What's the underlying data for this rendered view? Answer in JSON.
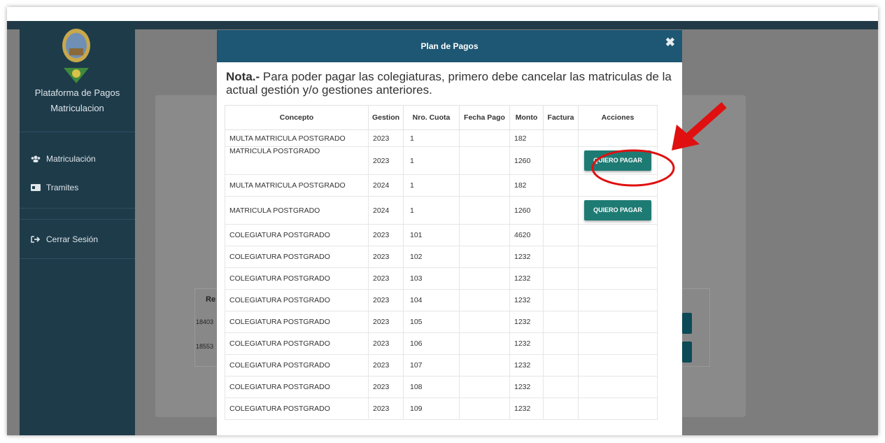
{
  "sidebar": {
    "brand_line1": "Plataforma de Pagos",
    "brand_line2": "Matriculacion",
    "items": [
      {
        "label": "Matriculación",
        "icon": "users-icon"
      },
      {
        "label": "Tramites",
        "icon": "id-card-icon"
      },
      {
        "label": "Cerrar Sesión",
        "icon": "sign-out-icon"
      }
    ]
  },
  "background": {
    "header_fragment": "Re",
    "row1_fragment": "18403",
    "row2_fragment": "18553"
  },
  "modal": {
    "title": "Plan de Pagos",
    "close_symbol": "✖",
    "note_bold": "Nota.-",
    "note_text": " Para poder pagar las colegiaturas, primero debe cancelar las matriculas de la actual gestión y/o gestiones anteriores."
  },
  "table": {
    "headers": [
      "Concepto",
      "Gestion",
      "Nro. Cuota",
      "Fecha Pago",
      "Monto",
      "Factura",
      "Acciones"
    ],
    "pay_label": "QUIERO PAGAR",
    "rows": [
      {
        "concepto": "MULTA MATRICULA POSTGRADO",
        "gestion": "2023",
        "cuota": "1",
        "fecha": "",
        "monto": "182",
        "factura": "",
        "accion": false
      },
      {
        "concepto": "MATRICULA POSTGRADO",
        "gestion": "2023",
        "cuota": "1",
        "fecha": "",
        "monto": "1260",
        "factura": "",
        "accion": true
      },
      {
        "concepto": "MULTA MATRICULA POSTGRADO",
        "gestion": "2024",
        "cuota": "1",
        "fecha": "",
        "monto": "182",
        "factura": "",
        "accion": false
      },
      {
        "concepto": "MATRICULA POSTGRADO",
        "gestion": "2024",
        "cuota": "1",
        "fecha": "",
        "monto": "1260",
        "factura": "",
        "accion": true
      },
      {
        "concepto": "COLEGIATURA POSTGRADO",
        "gestion": "2023",
        "cuota": "101",
        "fecha": "",
        "monto": "4620",
        "factura": "",
        "accion": false
      },
      {
        "concepto": "COLEGIATURA POSTGRADO",
        "gestion": "2023",
        "cuota": "102",
        "fecha": "",
        "monto": "1232",
        "factura": "",
        "accion": false
      },
      {
        "concepto": "COLEGIATURA POSTGRADO",
        "gestion": "2023",
        "cuota": "103",
        "fecha": "",
        "monto": "1232",
        "factura": "",
        "accion": false
      },
      {
        "concepto": "COLEGIATURA POSTGRADO",
        "gestion": "2023",
        "cuota": "104",
        "fecha": "",
        "monto": "1232",
        "factura": "",
        "accion": false
      },
      {
        "concepto": "COLEGIATURA POSTGRADO",
        "gestion": "2023",
        "cuota": "105",
        "fecha": "",
        "monto": "1232",
        "factura": "",
        "accion": false
      },
      {
        "concepto": "COLEGIATURA POSTGRADO",
        "gestion": "2023",
        "cuota": "106",
        "fecha": "",
        "monto": "1232",
        "factura": "",
        "accion": false
      },
      {
        "concepto": "COLEGIATURA POSTGRADO",
        "gestion": "2023",
        "cuota": "107",
        "fecha": "",
        "monto": "1232",
        "factura": "",
        "accion": false
      },
      {
        "concepto": "COLEGIATURA POSTGRADO",
        "gestion": "2023",
        "cuota": "108",
        "fecha": "",
        "monto": "1232",
        "factura": "",
        "accion": false
      },
      {
        "concepto": "COLEGIATURA POSTGRADO",
        "gestion": "2023",
        "cuota": "109",
        "fecha": "",
        "monto": "1232",
        "factura": "",
        "accion": false
      }
    ]
  },
  "colors": {
    "sidebar": "#1e3b4a",
    "modal_header": "#1e5773",
    "pay_button": "#1e7b74",
    "annotation": "#e01010"
  }
}
